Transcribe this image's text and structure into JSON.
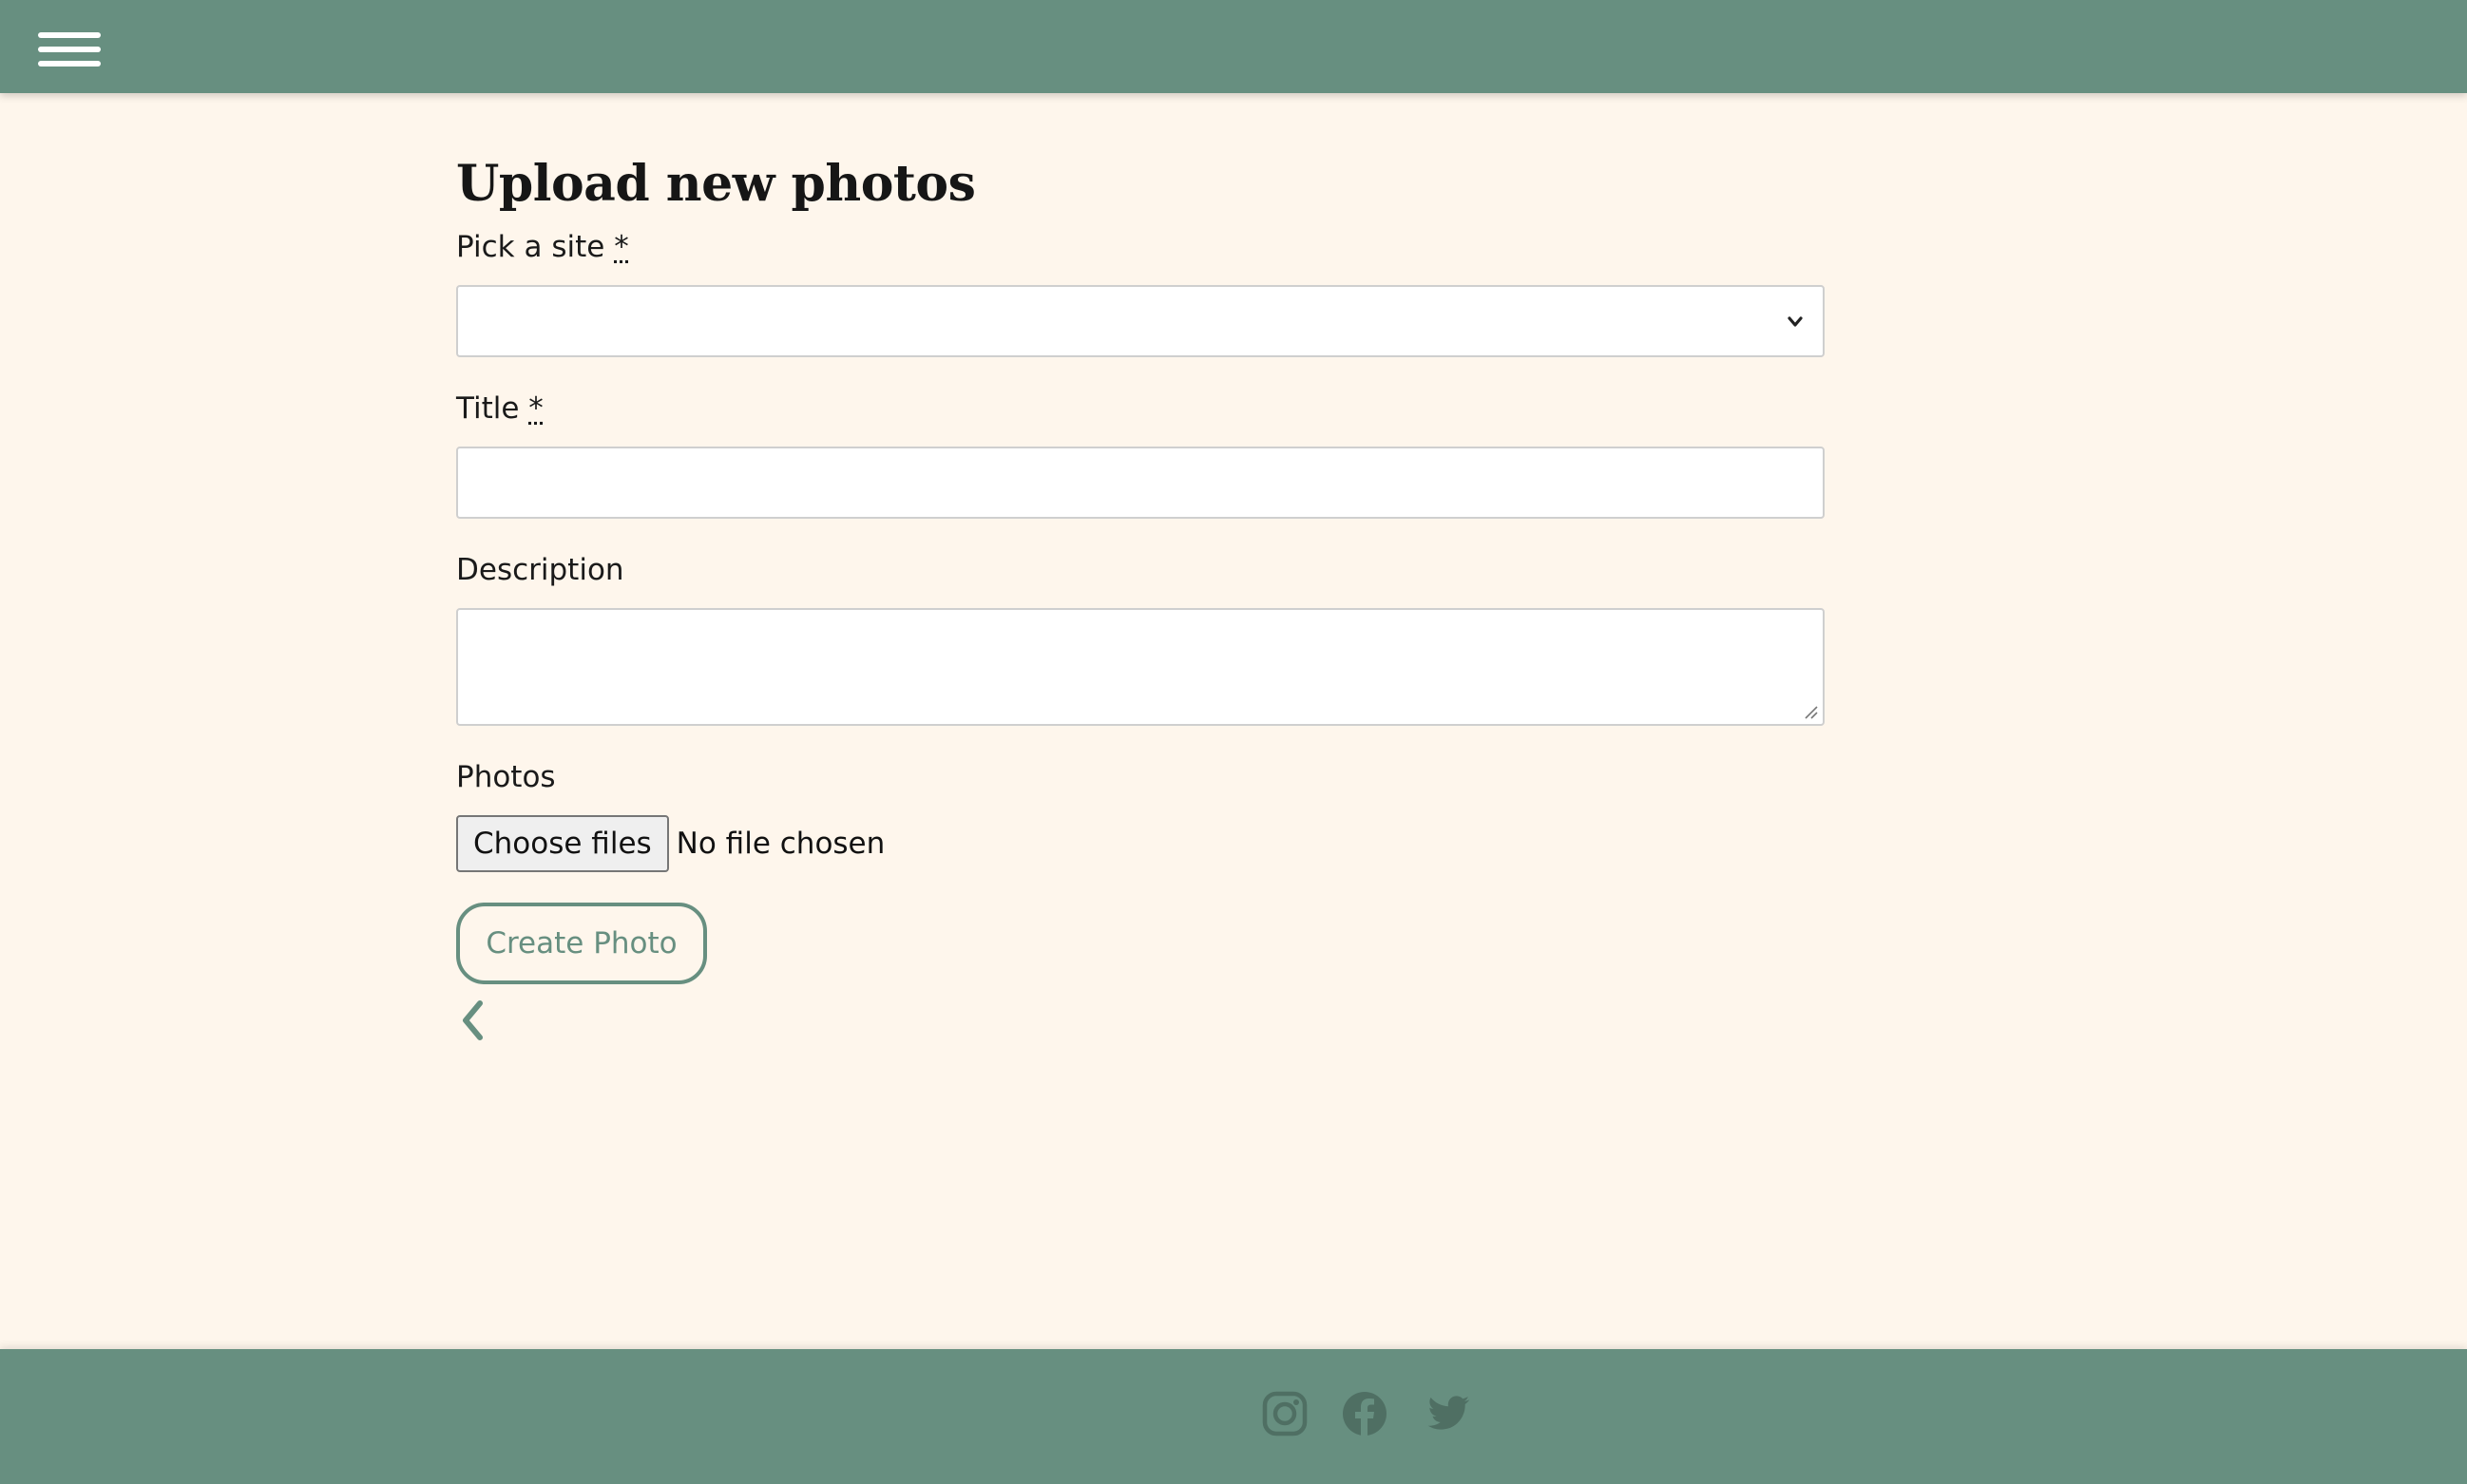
{
  "header": {
    "menu_icon": "hamburger-menu-icon"
  },
  "form": {
    "title": "Upload new photos",
    "site_label": "Pick a site",
    "site_required_mark": "*",
    "site_selected": "",
    "title_label": "Title",
    "title_required_mark": "*",
    "title_value": "",
    "description_label": "Description",
    "description_value": "",
    "photos_label": "Photos",
    "choose_files_label": "Choose files",
    "file_status": "No file chosen",
    "submit_label": "Create Photo",
    "back_icon": "chevron-left-icon"
  },
  "footer": {
    "social": [
      "instagram-icon",
      "facebook-icon",
      "twitter-icon"
    ]
  },
  "colors": {
    "brand": "#678f80",
    "background": "#fef6ec",
    "footer_icons": "#4f6f63"
  }
}
